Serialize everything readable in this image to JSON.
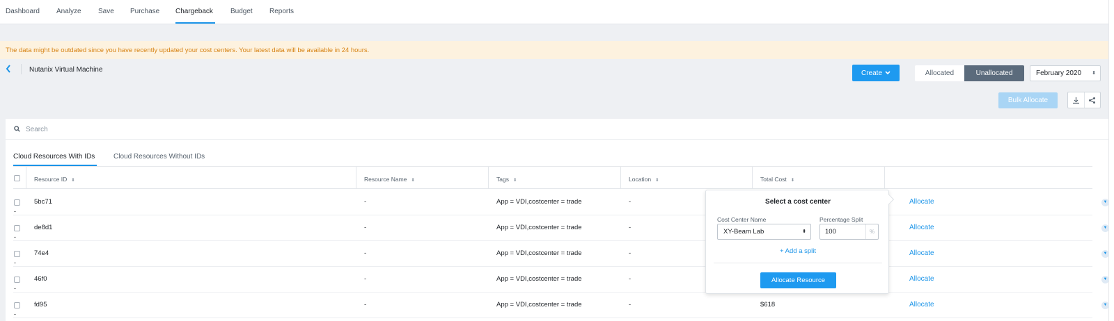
{
  "nav": {
    "items": [
      "Dashboard",
      "Analyze",
      "Save",
      "Purchase",
      "Chargeback",
      "Budget",
      "Reports"
    ],
    "active": "Chargeback"
  },
  "banner": {
    "text": "The data might be outdated since you have recently updated your cost centers. Your latest data will be available in 24 hours.",
    "color": "#d78416"
  },
  "header": {
    "breadcrumb": "Nutanix Virtual Machine",
    "create_label": "Create",
    "segment": {
      "allocated": "Allocated",
      "unallocated": "Unallocated",
      "selected": "Unallocated"
    },
    "month": "February 2020",
    "bulk_label": "Bulk Allocate",
    "icons": [
      "download-icon",
      "share-icon"
    ]
  },
  "search": {
    "placeholder": "Search"
  },
  "tabs": [
    "Cloud Resources With IDs",
    "Cloud Resources Without IDs"
  ],
  "table": {
    "columns": [
      "Resource ID",
      "Resource Name",
      "Tags",
      "Location",
      "Total Cost"
    ],
    "action_label": "Allocate",
    "rows": [
      {
        "id": "5bc71",
        "name": "-",
        "tags": "App = VDI,costcenter = trade",
        "location": "-",
        "cost": "",
        "sub": "-"
      },
      {
        "id": "de8d1",
        "name": "-",
        "tags": "App = VDI,costcenter = trade",
        "location": "-",
        "cost": "",
        "sub": "-"
      },
      {
        "id": "74e4",
        "name": "-",
        "tags": "App = VDI,costcenter = trade",
        "location": "-",
        "cost": "",
        "sub": "-"
      },
      {
        "id": "46f0",
        "name": "-",
        "tags": "App = VDI,costcenter = trade",
        "location": "-",
        "cost": "",
        "sub": "-"
      },
      {
        "id": "fd95",
        "name": "-",
        "tags": "App = VDI,costcenter = trade",
        "location": "-",
        "cost": "$618",
        "sub": "-"
      }
    ]
  },
  "popover": {
    "title": "Select a cost center",
    "cost_center_label": "Cost Center Name",
    "cost_center_value": "XY-Beam Lab",
    "split_label": "Percentage Split",
    "split_value": "100",
    "split_unit": "%",
    "add_split": "+ Add a split",
    "submit": "Allocate Resource"
  },
  "colors": {
    "accent": "#1b94e8",
    "segment_selected": "#5b6b7c",
    "banner_bg": "#fdf2df"
  }
}
